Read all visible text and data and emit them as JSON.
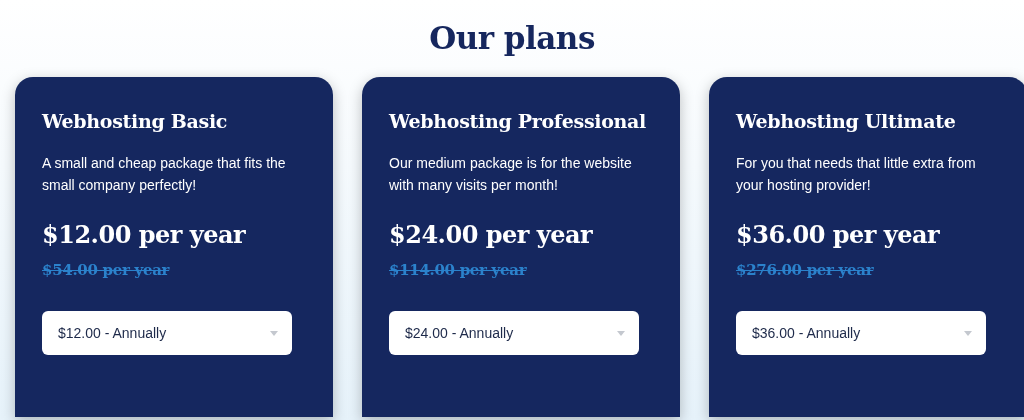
{
  "title": "Our plans",
  "plans": [
    {
      "name": "Webhosting Basic",
      "description": "A small and cheap package that fits the small company perfectly!",
      "price": "$12.00 per year",
      "old_price": "$54.00 per year",
      "billing": "$12.00 - Annually"
    },
    {
      "name": "Webhosting Professional",
      "description": "Our medium package is for the website with many visits per month!",
      "price": "$24.00 per year",
      "old_price": "$114.00 per year",
      "billing": "$24.00 - Annually"
    },
    {
      "name": "Webhosting Ultimate",
      "description": "For you that needs that little extra from your hosting provider!",
      "price": "$36.00 per year",
      "old_price": "$276.00 per year",
      "billing": "$36.00 - Annually"
    }
  ]
}
